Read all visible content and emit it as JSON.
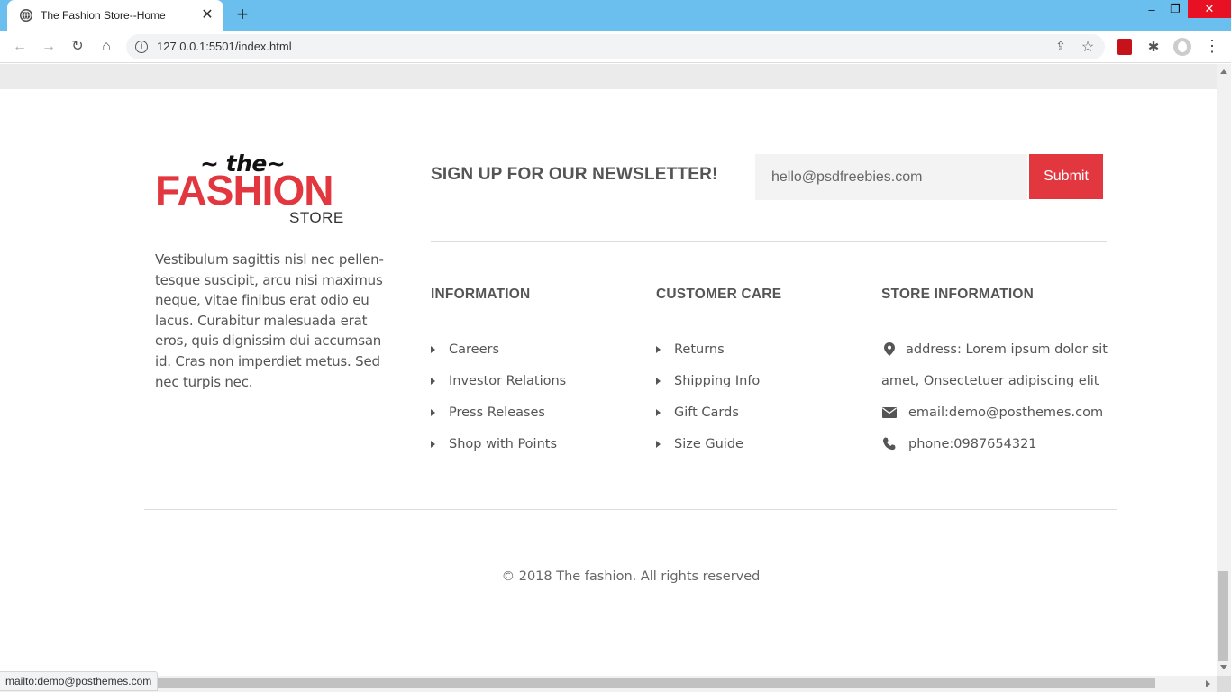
{
  "browser": {
    "tab_title": "The Fashion Store--Home",
    "url": "127.0.0.1:5501/index.html",
    "status_text": "mailto:demo@posthemes.com"
  },
  "logo": {
    "the": "~ the~",
    "fashion": "FASHION",
    "store": "STORE"
  },
  "about": "Vestibulum sagittis nisl nec pellen-tesque suscipit, arcu nisi maximus neque, vitae finibus erat odio eu lacus. Curabitur malesuada erat eros, quis dignissim dui accumsan id. Cras non imperdiet metus. Sed nec turpis nec.",
  "newsletter": {
    "title": "SIGN UP FOR OUR NEWSLETTER!",
    "input_value": "hello@psdfreebies.com",
    "submit_label": "Submit"
  },
  "information": {
    "heading": "INFORMATION",
    "items": [
      "Careers",
      "Investor Relations",
      "Press Releases",
      "Shop with Points"
    ]
  },
  "customer_care": {
    "heading": "CUSTOMER CARE",
    "items": [
      "Returns",
      "Shipping Info",
      "Gift Cards",
      "Size Guide"
    ]
  },
  "store_information": {
    "heading": "STORE INFORMATION",
    "address_line1": "address: Lorem ipsum dolor sit",
    "address_line2": "amet, Onsectetuer adipiscing elit",
    "email": "email:demo@posthemes.com",
    "phone": "phone:0987654321"
  },
  "footer": {
    "copyright": "© 2018 The fashion. All rights reserved"
  },
  "colors": {
    "accent": "#e2373f",
    "tabbar": "#6bbfef"
  }
}
